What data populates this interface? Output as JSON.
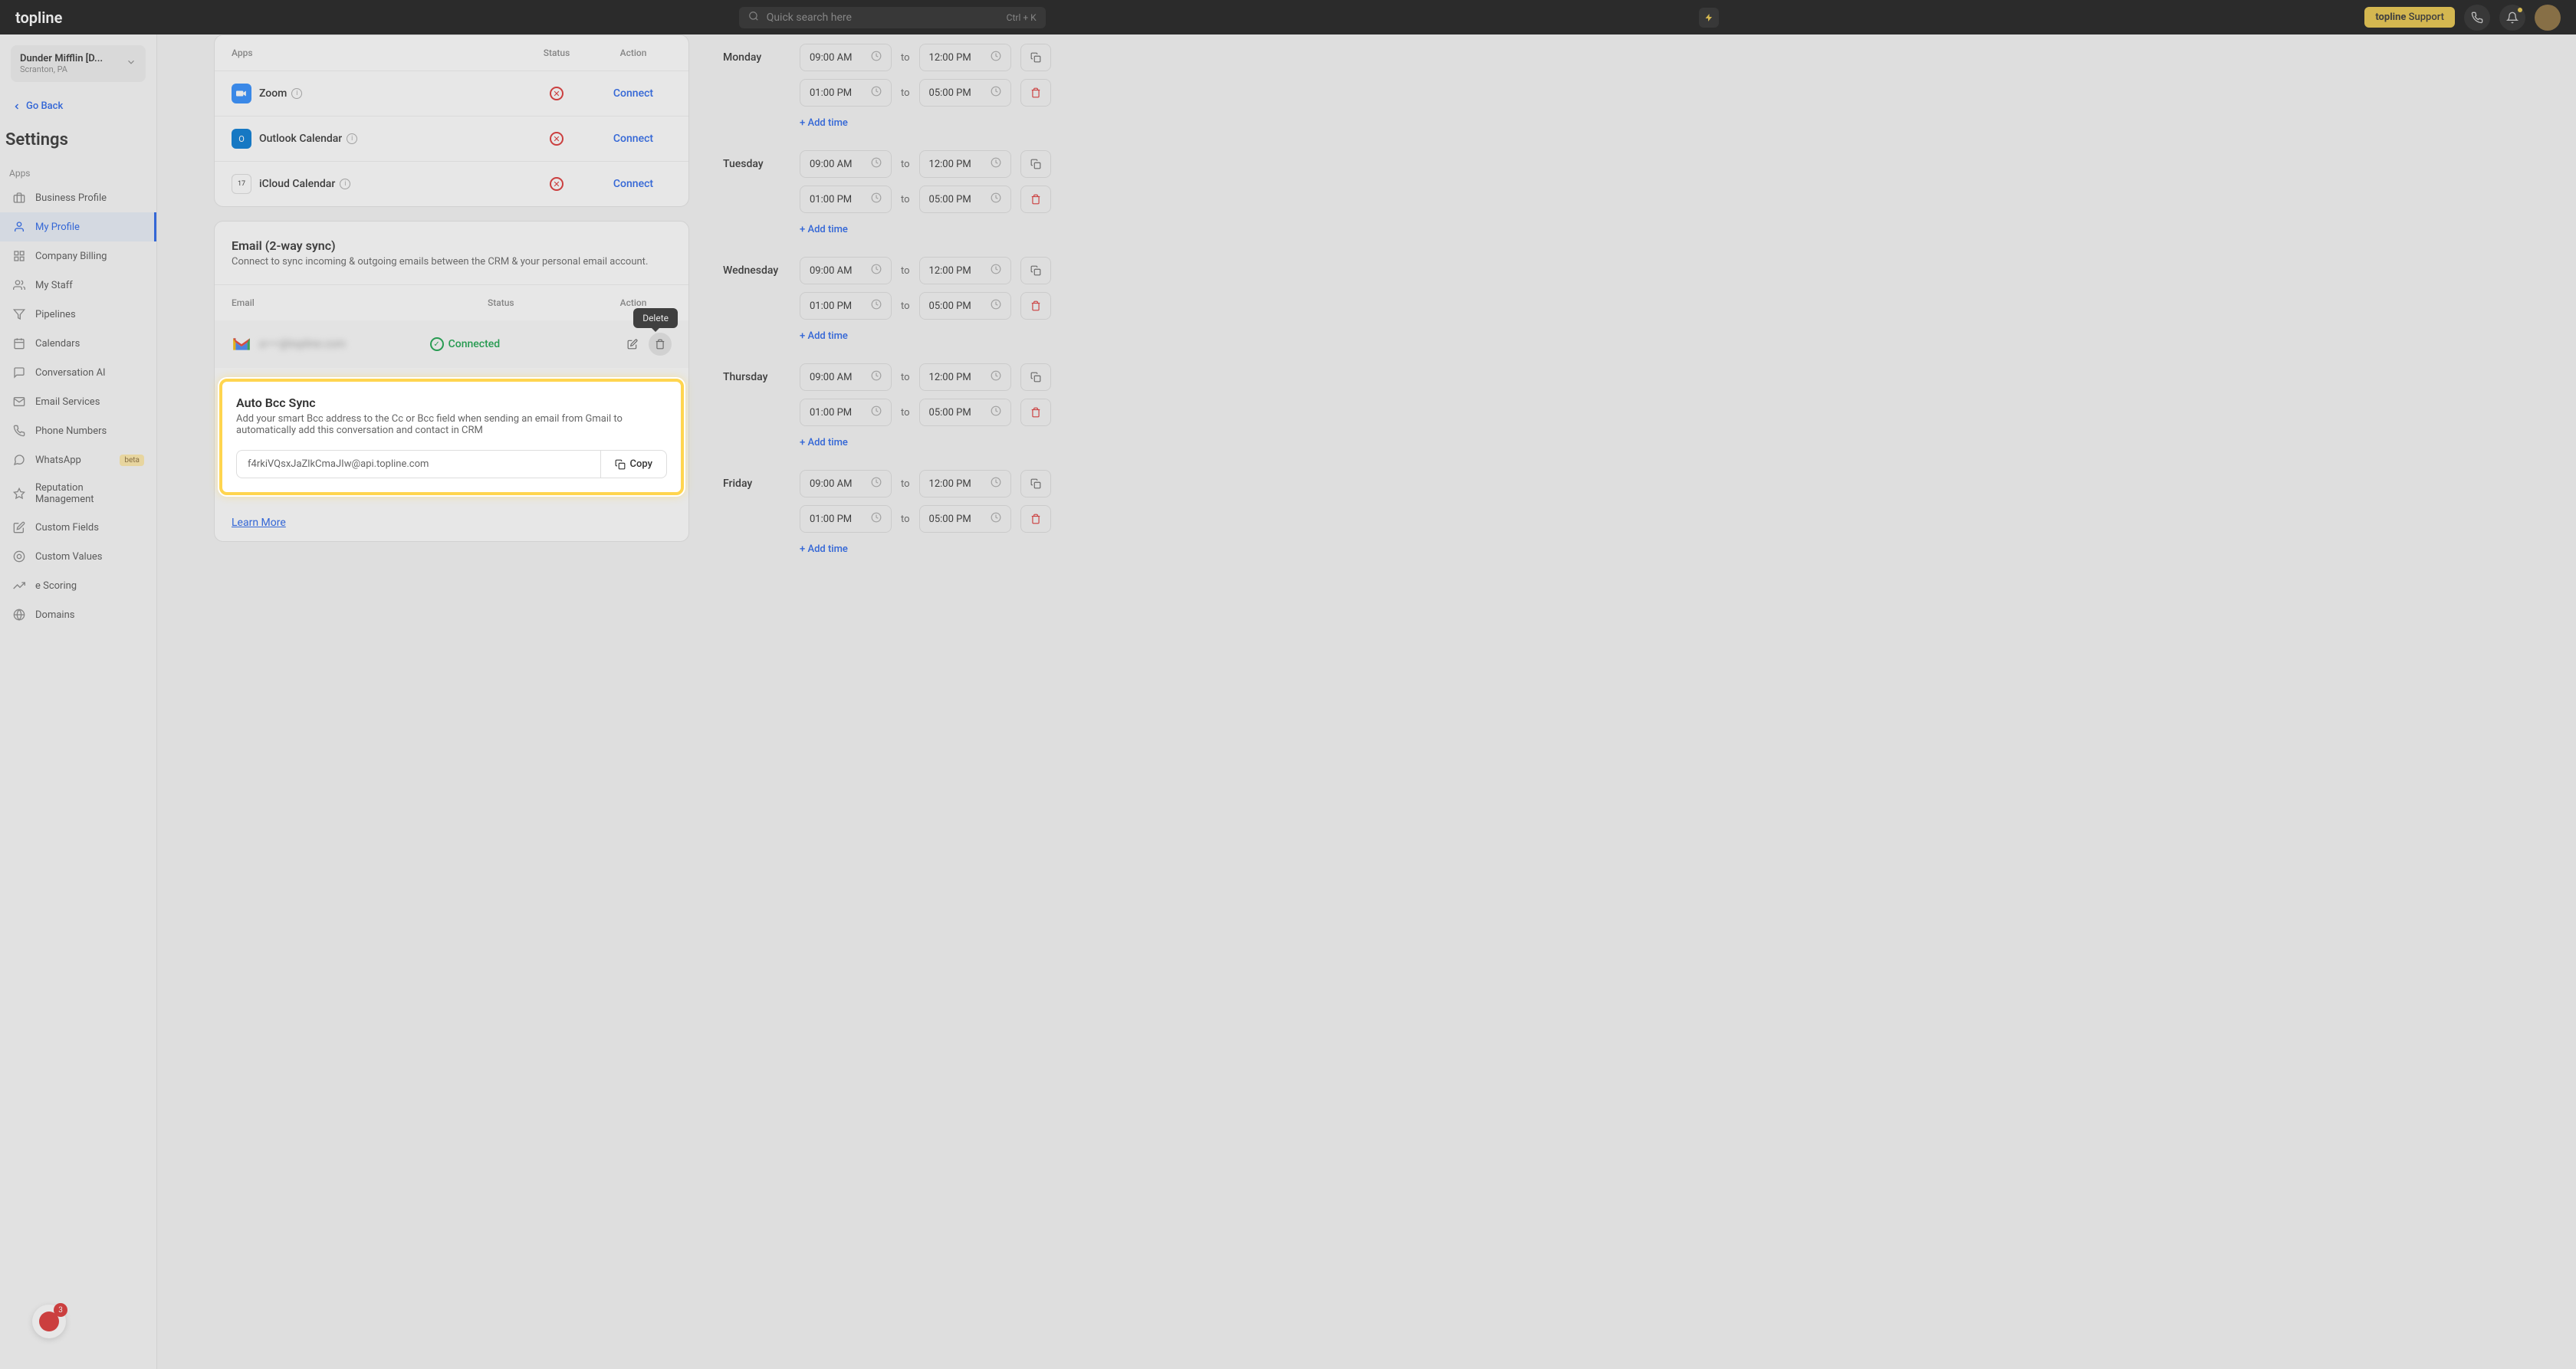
{
  "topbar": {
    "logo": "topline",
    "search_placeholder": "Quick search here",
    "search_shortcut": "Ctrl + K",
    "support_label": "topline Support"
  },
  "location": {
    "name": "Dunder Mifflin [D...",
    "sub": "Scranton, PA"
  },
  "go_back": "Go Back",
  "settings_title": "Settings",
  "sidebar": {
    "section": "Apps",
    "items": [
      {
        "label": "Business Profile"
      },
      {
        "label": "My Profile"
      },
      {
        "label": "Company Billing"
      },
      {
        "label": "My Staff"
      },
      {
        "label": "Pipelines"
      },
      {
        "label": "Calendars"
      },
      {
        "label": "Conversation AI"
      },
      {
        "label": "Email Services"
      },
      {
        "label": "Phone Numbers"
      },
      {
        "label": "WhatsApp",
        "badge": "beta"
      },
      {
        "label": "Reputation Management"
      },
      {
        "label": "Custom Fields"
      },
      {
        "label": "Custom Values"
      },
      {
        "label": "e Scoring"
      },
      {
        "label": "Domains"
      }
    ],
    "float_count": "3"
  },
  "apps_card": {
    "headers": {
      "apps": "Apps",
      "status": "Status",
      "action": "Action"
    },
    "rows": [
      {
        "name": "Zoom",
        "action": "Connect"
      },
      {
        "name": "Outlook Calendar",
        "action": "Connect"
      },
      {
        "name": "iCloud Calendar",
        "action": "Connect"
      }
    ]
  },
  "email_card": {
    "title": "Email (2-way sync)",
    "desc": "Connect to sync incoming & outgoing emails between the CRM & your personal email account.",
    "headers": {
      "email": "Email",
      "status": "Status",
      "action": "Action"
    },
    "email_addr": "a••••@topline.com",
    "connected": "Connected",
    "tooltip": "Delete"
  },
  "bcc_card": {
    "title": "Auto Bcc Sync",
    "desc": "Add your smart Bcc address to the Cc or Bcc field when sending an email from Gmail to automatically add this conversation and contact in CRM",
    "address": "f4rkiVQsxJaZlkCmaJIw@api.topline.com",
    "copy": "Copy",
    "learn_more": "Learn More"
  },
  "schedule": {
    "to": "to",
    "add_time": "+ Add time",
    "days": [
      {
        "name": "Monday",
        "slots": [
          {
            "from": "09:00 AM",
            "to": "12:00 PM"
          },
          {
            "from": "01:00 PM",
            "to": "05:00 PM"
          }
        ]
      },
      {
        "name": "Tuesday",
        "slots": [
          {
            "from": "09:00 AM",
            "to": "12:00 PM"
          },
          {
            "from": "01:00 PM",
            "to": "05:00 PM"
          }
        ]
      },
      {
        "name": "Wednesday",
        "slots": [
          {
            "from": "09:00 AM",
            "to": "12:00 PM"
          },
          {
            "from": "01:00 PM",
            "to": "05:00 PM"
          }
        ]
      },
      {
        "name": "Thursday",
        "slots": [
          {
            "from": "09:00 AM",
            "to": "12:00 PM"
          },
          {
            "from": "01:00 PM",
            "to": "05:00 PM"
          }
        ]
      },
      {
        "name": "Friday",
        "slots": [
          {
            "from": "09:00 AM",
            "to": "12:00 PM"
          },
          {
            "from": "01:00 PM",
            "to": "05:00 PM"
          }
        ]
      }
    ]
  }
}
